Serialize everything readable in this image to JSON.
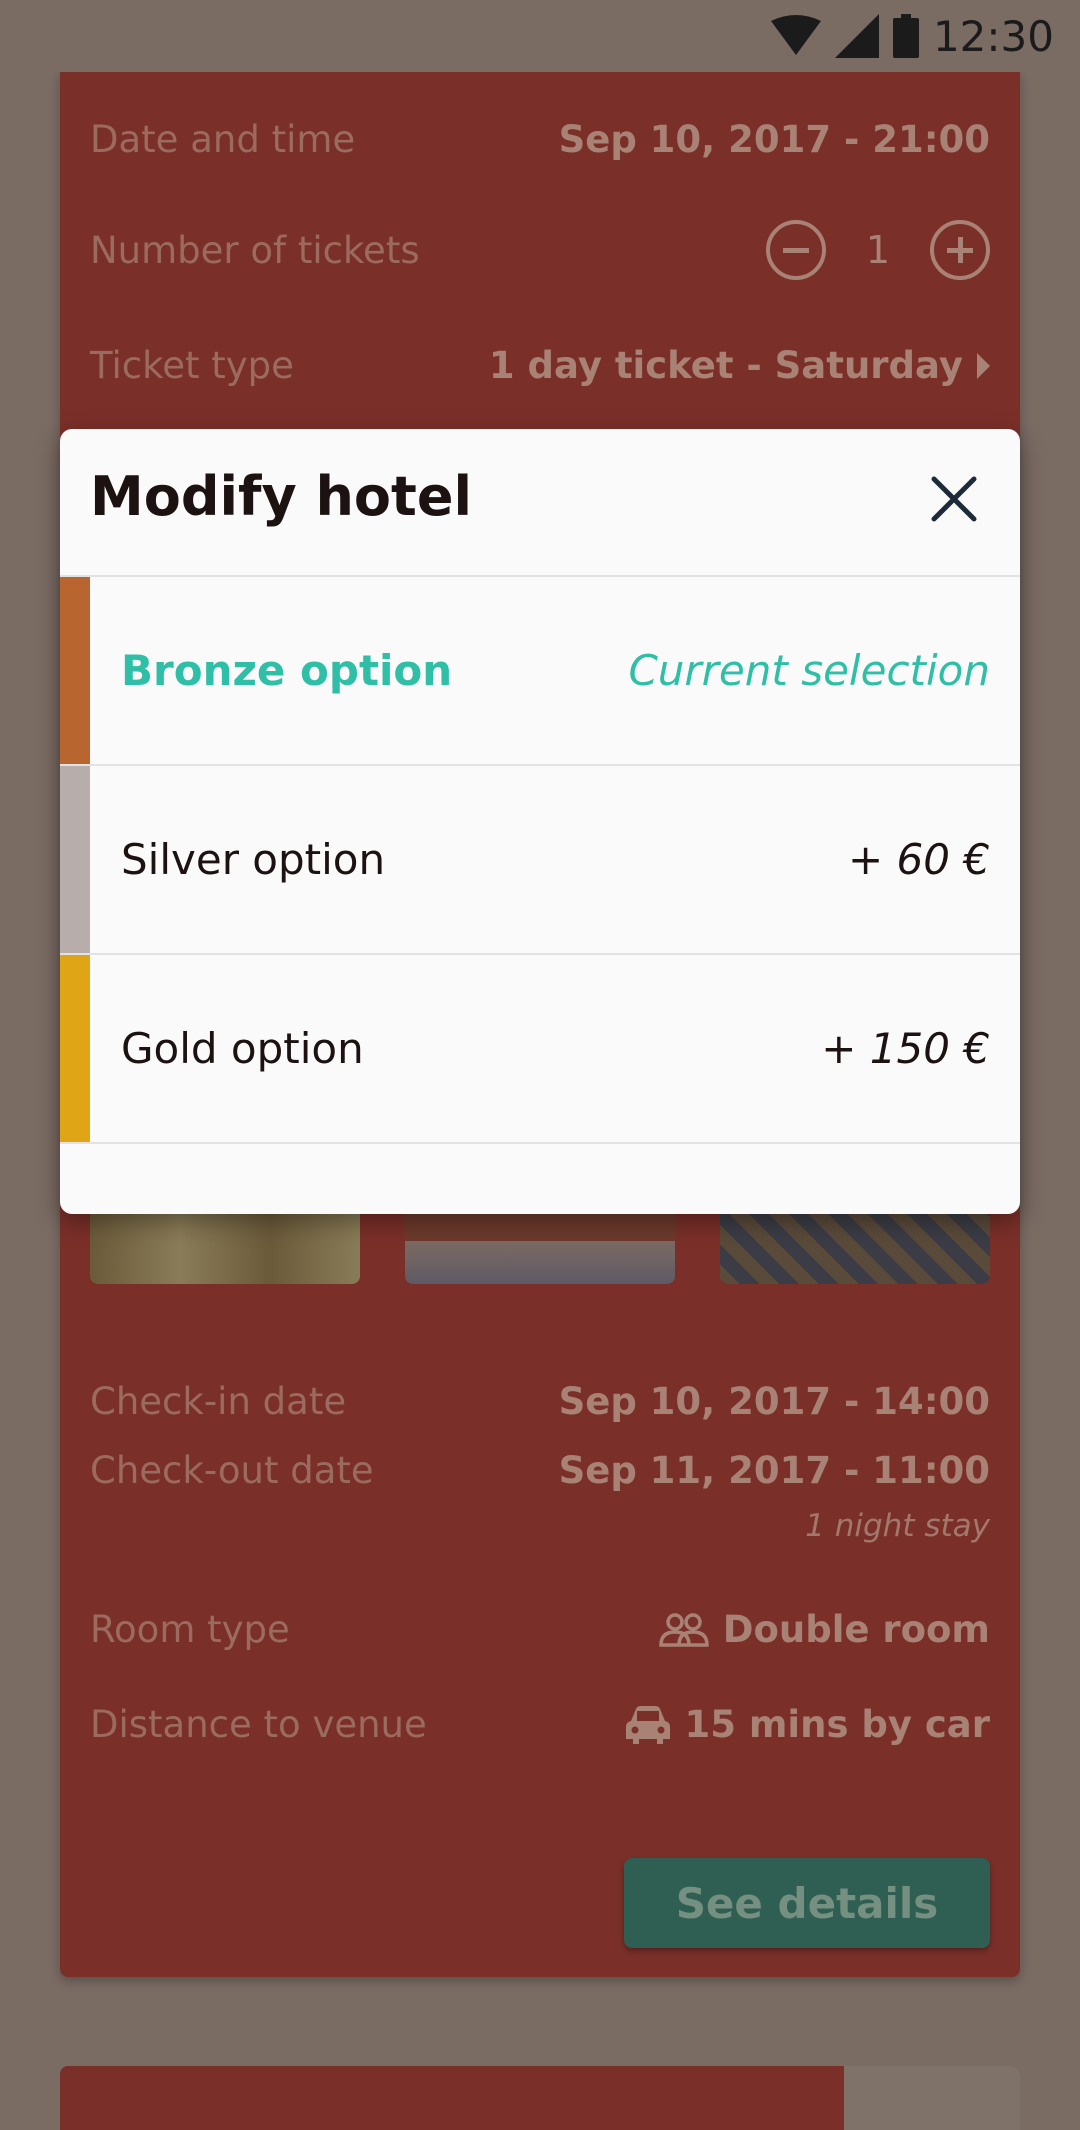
{
  "status_bar": {
    "time": "12:30",
    "icons": [
      "wifi-icon",
      "signal-icon",
      "battery-icon"
    ]
  },
  "booking": {
    "date_label": "Date and time",
    "date_value": "Sep 10, 2017 - 21:00",
    "tickets_label": "Number of tickets",
    "tickets_count": "1",
    "ticket_type_label": "Ticket type",
    "ticket_type_value": "1 day ticket - Saturday"
  },
  "hotel": {
    "checkin_label": "Check-in date",
    "checkin_value": "Sep 10, 2017 - 14:00",
    "checkout_label": "Check-out date",
    "checkout_value": "Sep 11, 2017 - 11:00",
    "stay_note": "1 night stay",
    "room_label": "Room type",
    "room_value": "Double room",
    "distance_label": "Distance to venue",
    "distance_value": "15 mins by car",
    "see_details": "See details"
  },
  "modal": {
    "title": "Modify hotel",
    "options": [
      {
        "name": "Bronze option",
        "price": "Current selection",
        "color": "#b8652f",
        "current": true
      },
      {
        "name": "Silver option",
        "price": "+ 60 €",
        "color": "#b7aeac",
        "current": false
      },
      {
        "name": "Gold option",
        "price": "+ 150 €",
        "color": "#e0a516",
        "current": false
      }
    ]
  },
  "colors": {
    "accent": "#2fbfa7",
    "card": "#7b2f29",
    "scrim": "#7a6b63"
  }
}
